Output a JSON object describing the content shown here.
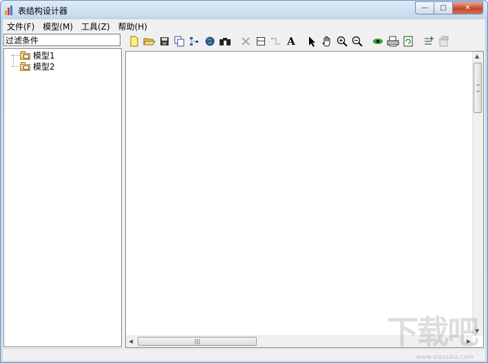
{
  "window": {
    "title": "表结构设计器"
  },
  "caption": {
    "minimize": "—",
    "maximize": "□",
    "close": "✕"
  },
  "menu": [
    {
      "label": "文件(F)"
    },
    {
      "label": "模型(M)"
    },
    {
      "label": "工具(Z)"
    },
    {
      "label": "帮助(H)"
    }
  ],
  "filter": {
    "label": "过滤条件"
  },
  "tree": {
    "items": [
      {
        "label": "模型1"
      },
      {
        "label": "模型2"
      }
    ]
  },
  "toolbar": {
    "icons": [
      "new-file-icon",
      "open-folder-icon",
      "save-icon",
      "copy-icon",
      "tree-icon",
      "globe-icon",
      "binoculars-icon",
      "delete-icon",
      "table-icon",
      "connector-icon",
      "text-icon",
      "pointer-icon",
      "hand-icon",
      "zoom-in-icon",
      "zoom-out-icon",
      "eye-icon",
      "print-icon",
      "refresh-icon",
      "add-list-icon",
      "properties-icon"
    ],
    "text_glyph": "A"
  },
  "scrollbar": {
    "grip": "|||"
  },
  "watermark": {
    "text": "下载吧",
    "sub": "www.xiazaiba.com"
  },
  "colors": {
    "accent": "#6d8fb5",
    "close": "#c4452a"
  }
}
